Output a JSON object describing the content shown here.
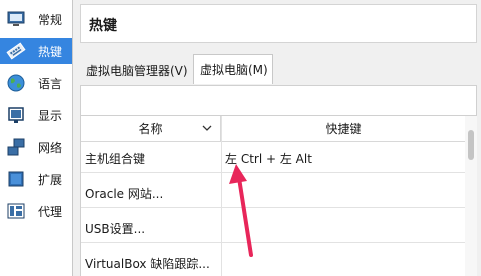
{
  "sidebar": {
    "items": [
      {
        "label": "常规",
        "icon": "monitor-icon"
      },
      {
        "label": "热键",
        "icon": "keyboard-icon",
        "active": true
      },
      {
        "label": "语言",
        "icon": "globe-icon"
      },
      {
        "label": "显示",
        "icon": "display-icon"
      },
      {
        "label": "网络",
        "icon": "network-icon"
      },
      {
        "label": "扩展",
        "icon": "extension-icon"
      },
      {
        "label": "代理",
        "icon": "proxy-icon"
      }
    ]
  },
  "header": {
    "title": "热键"
  },
  "tabs": [
    {
      "label": "虚拟电脑管理器(V)",
      "active": false
    },
    {
      "label": "虚拟电脑(M)",
      "active": true
    }
  ],
  "filter": {
    "value": ""
  },
  "table": {
    "columns": [
      "名称",
      "快捷键"
    ],
    "rows": [
      {
        "name": "主机组合键",
        "shortcut": "左 Ctrl + 左 Alt"
      },
      {
        "name": "Oracle 网站...",
        "shortcut": ""
      },
      {
        "name": "USB设置...",
        "shortcut": ""
      },
      {
        "name": "VirtualBox 缺陷跟踪...",
        "shortcut": ""
      }
    ]
  },
  "colors": {
    "accent": "#3585e0",
    "annotation": "#e8265a"
  }
}
